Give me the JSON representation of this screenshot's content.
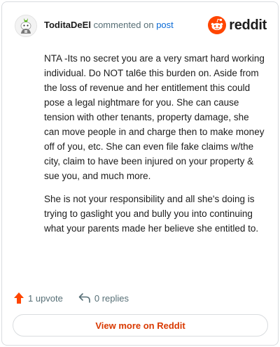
{
  "comment": {
    "username": "ToditaDeEl",
    "action_text": "commented on",
    "post_link_label": "post",
    "paragraphs": [
      "NTA -Its no secret you are a very smart hard working individual. Do NOT tal6e this burden on. Aside from the loss of revenue and her entitlement this could pose a legal nightmare for you. She can cause tension with other tenants, property damage, she can move people in and charge then to make money off of you, etc. She can even file fake claims w/the city, claim to have been injured on your property & sue you, and much more.",
      "She is not your responsibility and all she's doing is trying to gaslight you and bully you into continuing what your parents made her believe she entitled to."
    ]
  },
  "brand": {
    "wordmark": "reddit",
    "icon": "reddit-snoo-icon",
    "color": "#ff4500"
  },
  "footer": {
    "upvote_label": "1 upvote",
    "upvote_icon": "upvote-arrow-icon",
    "upvote_color": "#ff4500",
    "replies_label": "0 replies",
    "replies_icon": "reply-arrow-icon"
  },
  "view_more_label": "View more on Reddit",
  "accent_color": "#d93900",
  "link_color": "#0a6ad6"
}
